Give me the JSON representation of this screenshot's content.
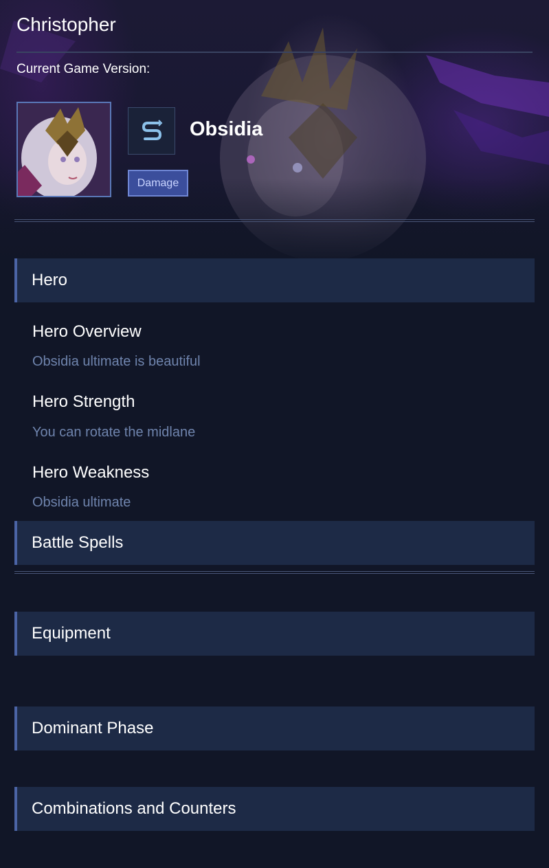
{
  "header": {
    "user_name": "Christopher",
    "version_label": "Current Game Version:"
  },
  "hero": {
    "name": "Obsidia",
    "role": "Damage",
    "role_icon": "lane-s-icon",
    "portrait_icon": "hero-portrait"
  },
  "sections": {
    "hero": {
      "title": "Hero",
      "items": [
        {
          "title": "Hero Overview",
          "desc": "Obsidia ultimate is beautiful"
        },
        {
          "title": "Hero Strength",
          "desc": "You can rotate the midlane"
        },
        {
          "title": "Hero Weakness",
          "desc": "Obsidia ultimate"
        }
      ]
    },
    "battle_spells": {
      "title": "Battle Spells"
    },
    "equipment": {
      "title": "Equipment"
    },
    "dominant_phase": {
      "title": "Dominant Phase"
    },
    "combos": {
      "title": "Combinations and Counters"
    }
  },
  "colors": {
    "background": "#111627",
    "section_header": "#1d2a46",
    "accent": "#4b64a6",
    "badge": "#3b4e9c",
    "muted_text": "#6f84ad"
  }
}
